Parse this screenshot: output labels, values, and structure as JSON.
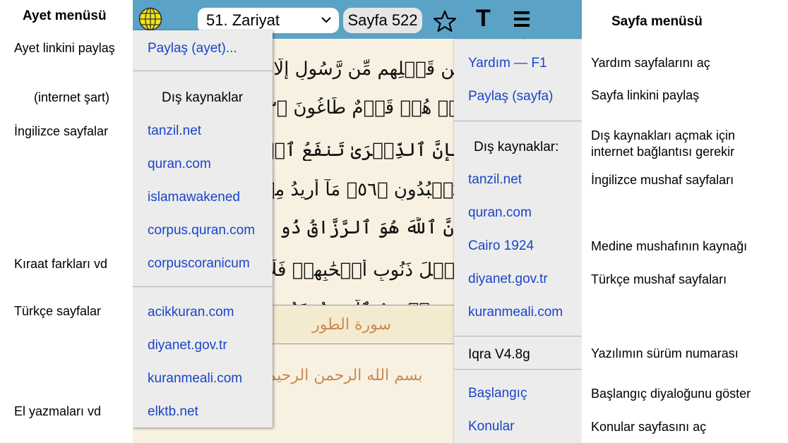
{
  "left_annotations": {
    "title": "Ayet menüsü",
    "share_link": "Ayet linkini paylaş",
    "internet": "(internet şart)",
    "english_pages": "İngilizce sayfalar",
    "kiraat": "Kıraat farkları vd",
    "turkish_pages": "Türkçe sayfalar",
    "manuscripts": "El yazmaları vd"
  },
  "toolbar": {
    "surah": "51. Zariyat",
    "page": "Sayfa 522",
    "text_button": "T"
  },
  "quran_text": {
    "line1": "مِن قَبۡلِهِم مِّن رَّسُولٍ إِلَّا قَالُ",
    "line2": "بَلۡ هُمۡ قَوۡمٌ طَاغُونَ ﴿٥٣﴾ فَ",
    "line3": "فَإِنَّ ٱلذِّكۡرَىٰ تَنفَعُ ٱلۡمُؤۡمِنِينَ",
    "line4": "لِيَعۡبُدُونِ ﴿٥٦﴾ مَآ أُرِيدُ مِنۡهُم",
    "line5": "إِنَّ ٱللَّهَ هُوَ ٱلرَّزَّاقُ ذُو ٱلۡقُوَّ",
    "line6": "مِّثۡلَ ذَنُوبِ أَصۡحَٰبِهِمۡ فَلَا",
    "line7": "مِن يَوۡمِهِمُ ٱلَّذِي يُوعَدُونَ ﴿٦٠",
    "surah_name": "سورة الطور",
    "basmala": "بسم الله الرحمن الرحيم"
  },
  "ayet_menu": {
    "share": "Paylaş (ayet)...",
    "external_header": "Dış kaynaklar",
    "items_en": [
      "tanzil.net",
      "quran.com",
      "islamawakened",
      "corpus.quran.com",
      "corpuscoranicum"
    ],
    "items_tr": [
      "acikkuran.com",
      "diyanet.gov.tr",
      "kuranmeali.com",
      "elktb.net"
    ]
  },
  "sayfa_menu": {
    "help": "Yardım — F1",
    "share": "Paylaş (sayfa)",
    "external_header": "Dış kaynaklar:",
    "items": [
      "tanzil.net",
      "quran.com",
      "Cairo 1924",
      "diyanet.gov.tr",
      "kuranmeali.com"
    ],
    "version": "Iqra V4.8g",
    "start": "Başlangıç",
    "topics": "Konular"
  },
  "right_annotations": {
    "title": "Sayfa menüsü",
    "help": "Yardım sayfalarını aç",
    "share": "Sayfa linkini paylaş",
    "external1": "Dış kaynakları açmak için",
    "external2": "internet bağlantısı gerekir",
    "english": "İngilizce mushaf  sayfaları",
    "medine": "Medine mushafının kaynağı",
    "turkish": "Türkçe mushaf  sayfaları",
    "version": "Yazılımın sürüm numarası",
    "start": "Başlangıç diyaloğunu göster",
    "topics": "Konular sayfasını aç"
  },
  "colors": {
    "toolbar": "#5ba3c6",
    "link": "#1a44c8",
    "page_bg": "#f8f1e1",
    "menu_bg": "#ececec"
  }
}
